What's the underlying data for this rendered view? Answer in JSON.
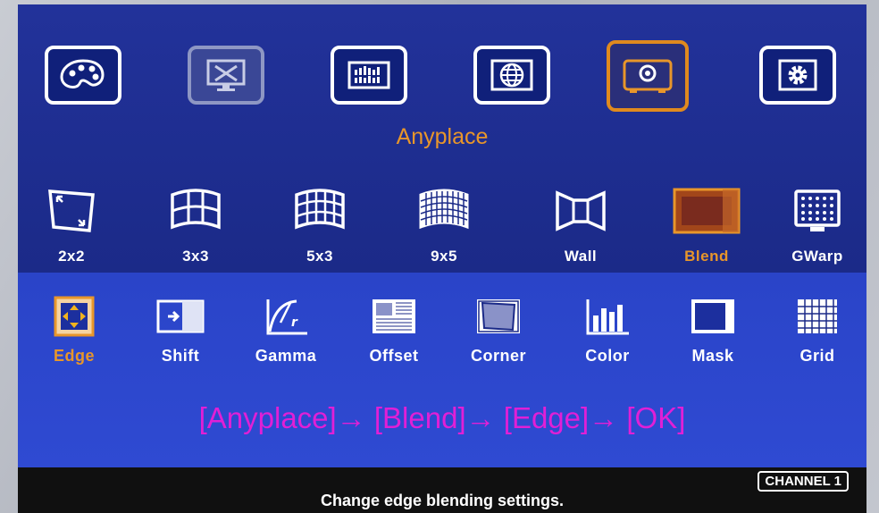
{
  "main_menu": {
    "items": [
      {
        "name": "palette-icon",
        "label": ""
      },
      {
        "name": "monitor-tools-icon",
        "label": ""
      },
      {
        "name": "signal-bars-icon",
        "label": ""
      },
      {
        "name": "globe-icon",
        "label": ""
      },
      {
        "name": "projector-icon",
        "label": ""
      },
      {
        "name": "gear-icon",
        "label": ""
      }
    ],
    "selected_title": "Anyplace"
  },
  "modes": {
    "items": [
      {
        "icon": "quad-warp-icon",
        "label": "2x2"
      },
      {
        "icon": "curved-grid-3x3-icon",
        "label": "3x3"
      },
      {
        "icon": "curved-grid-5x3-icon",
        "label": "5x3"
      },
      {
        "icon": "curved-grid-9x5-icon",
        "label": "9x5"
      },
      {
        "icon": "wall-icon",
        "label": "Wall"
      },
      {
        "icon": "blend-icon",
        "label": "Blend"
      },
      {
        "icon": "gwarp-icon",
        "label": "GWarp"
      }
    ],
    "selected": "Blend"
  },
  "submenu": {
    "items": [
      {
        "icon": "edge-icon",
        "label": "Edge"
      },
      {
        "icon": "shift-icon",
        "label": "Shift"
      },
      {
        "icon": "gamma-icon",
        "label": "Gamma"
      },
      {
        "icon": "offset-icon",
        "label": "Offset"
      },
      {
        "icon": "corner-icon",
        "label": "Corner"
      },
      {
        "icon": "color-icon",
        "label": "Color"
      },
      {
        "icon": "mask-icon",
        "label": "Mask"
      },
      {
        "icon": "grid-icon",
        "label": "Grid"
      }
    ],
    "selected": "Edge"
  },
  "path_hint": "[Anyplace]→ [Blend]→ [Edge]→ [OK]",
  "status": {
    "channel": "CHANNEL 1",
    "message": "Change edge blending settings."
  },
  "colors": {
    "screen_blue": "#1d2e8f",
    "submenu_blue": "#2f4ad2",
    "selection_orange": "#e8962a",
    "hint_magenta": "#e11fd6"
  }
}
